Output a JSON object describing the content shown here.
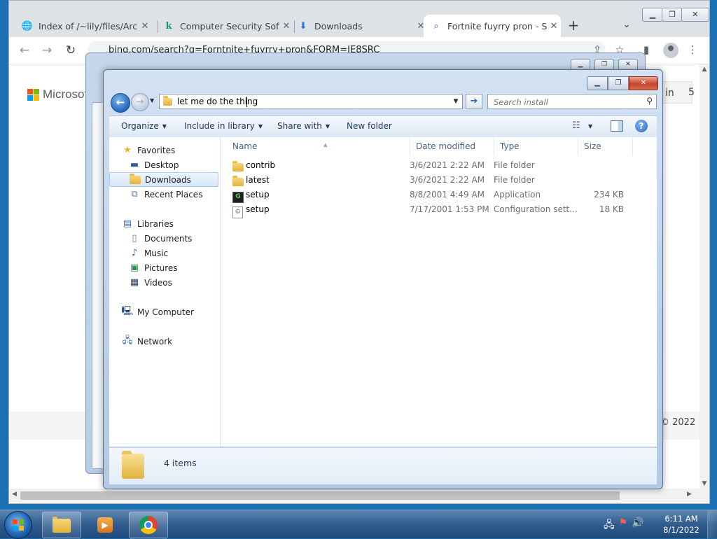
{
  "browser": {
    "tabs": [
      {
        "label": "Index of /~lily/files/Arch",
        "icon": "globe-icon"
      },
      {
        "label": "Computer Security Softw",
        "icon": "kaspersky-k-icon"
      },
      {
        "label": "Downloads",
        "icon": "download-arrow-icon"
      },
      {
        "label": "Fortnite fuyrry pron - S",
        "icon": "search-icon"
      }
    ],
    "close_glyph": "✕",
    "new_tab_glyph": "+",
    "url": "bing.com/search?q=Forntnite+fuyrry+pron&FORM=IE8SRC",
    "page": {
      "brand": "Microsoft",
      "sign_in": "in",
      "rewards_count": "5",
      "copyright": "© 2022"
    }
  },
  "explorer": {
    "address": "let me do the thing",
    "search_placeholder": "Search install",
    "commands": {
      "organize": "Organize",
      "include": "Include in library",
      "share": "Share with",
      "new_folder": "New folder"
    },
    "nav": {
      "favorites": "Favorites",
      "desktop": "Desktop",
      "downloads": "Downloads",
      "recent": "Recent Places",
      "libraries": "Libraries",
      "documents": "Documents",
      "music": "Music",
      "pictures": "Pictures",
      "videos": "Videos",
      "computer": "My Computer",
      "network": "Network"
    },
    "columns": {
      "name": "Name",
      "date": "Date modified",
      "type": "Type",
      "size": "Size"
    },
    "files": [
      {
        "name": "contrib",
        "date": "3/6/2021 2:22 AM",
        "type": "File folder",
        "size": "",
        "icon": "folder-icon"
      },
      {
        "name": "latest",
        "date": "3/6/2021 2:22 AM",
        "type": "File folder",
        "size": "",
        "icon": "folder-icon"
      },
      {
        "name": "setup",
        "date": "8/8/2001 4:49 AM",
        "type": "Application",
        "size": "234 KB",
        "icon": "application-icon"
      },
      {
        "name": "setup",
        "date": "7/17/2001 1:53 PM",
        "type": "Configuration sett...",
        "size": "18 KB",
        "icon": "config-file-icon"
      }
    ],
    "item_count": "4 items"
  },
  "taskbar": {
    "time": "6:11 AM",
    "date": "8/1/2022"
  },
  "colors": {
    "ms_red": "#f25022",
    "ms_green": "#7fba00",
    "ms_blue": "#00a4ef",
    "ms_yellow": "#ffb900",
    "desktop": "#1b6fb3",
    "close_red": "#c9432a"
  }
}
